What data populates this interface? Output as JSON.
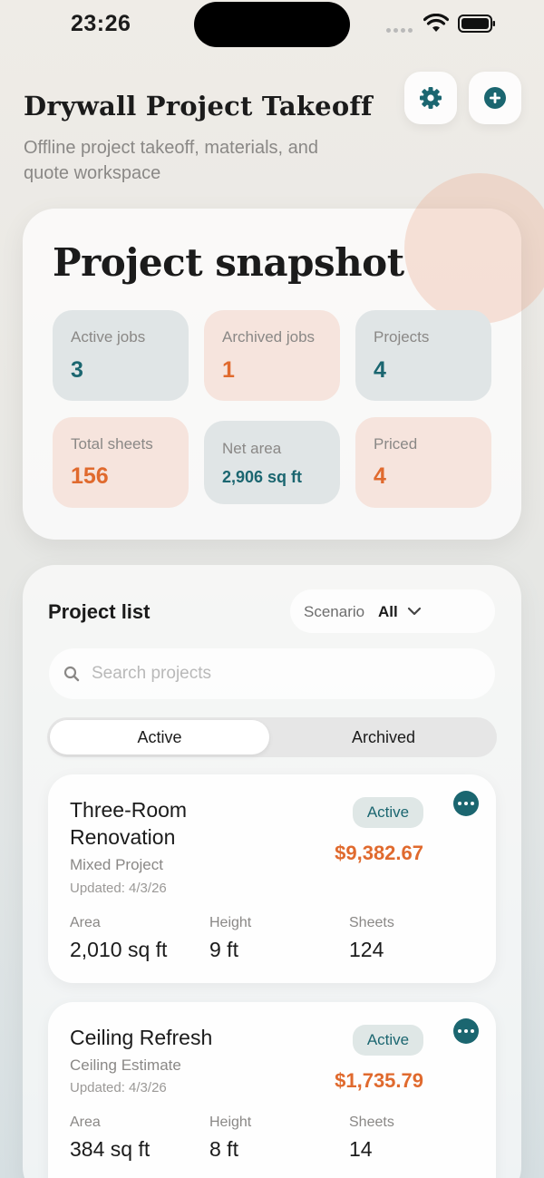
{
  "status_bar": {
    "time": "23:26"
  },
  "header": {
    "title": "Drywall Project Takeoff",
    "subtitle": "Offline project takeoff, materials, and quote workspace",
    "settings_icon": "gear-icon",
    "add_icon": "plus-circle-icon"
  },
  "snapshot": {
    "title": "Project snapshot",
    "stats": [
      {
        "label": "Active jobs",
        "value": "3"
      },
      {
        "label": "Archived jobs",
        "value": "1"
      },
      {
        "label": "Projects",
        "value": "4"
      },
      {
        "label": "Total sheets",
        "value": "156"
      },
      {
        "label": "Net area",
        "value": "2,906 sq ft"
      },
      {
        "label": "Priced",
        "value": "4"
      }
    ]
  },
  "project_list": {
    "title": "Project list",
    "scenario_label": "Scenario",
    "scenario_value": "All",
    "search_placeholder": "Search projects",
    "tabs": [
      {
        "label": "Active",
        "selected": true
      },
      {
        "label": "Archived",
        "selected": false
      }
    ],
    "projects": [
      {
        "name": "Three-Room Renovation",
        "type": "Mixed Project",
        "updated": "Updated: 4/3/26",
        "status": "Active",
        "price": "$9,382.67",
        "metrics": [
          {
            "label": "Area",
            "value": "2,010 sq ft"
          },
          {
            "label": "Height",
            "value": "9 ft"
          },
          {
            "label": "Sheets",
            "value": "124"
          }
        ]
      },
      {
        "name": "Ceiling Refresh",
        "type": "Ceiling Estimate",
        "updated": "Updated: 4/3/26",
        "status": "Active",
        "price": "$1,735.79",
        "metrics": [
          {
            "label": "Area",
            "value": "384 sq ft"
          },
          {
            "label": "Height",
            "value": "8 ft"
          },
          {
            "label": "Sheets",
            "value": "14"
          }
        ]
      }
    ]
  },
  "colors": {
    "accent_teal": "#1b6670",
    "accent_orange": "#e06a2e",
    "tile_teal": "#e0e5e6",
    "tile_peach": "#f6e4dd"
  }
}
